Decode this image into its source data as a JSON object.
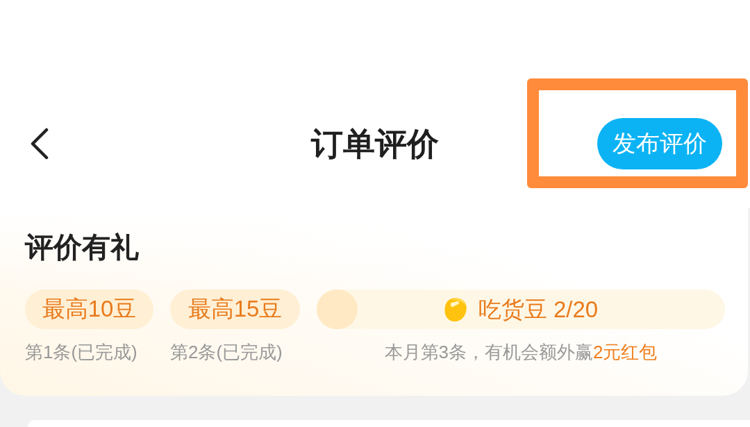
{
  "header": {
    "title": "订单评价",
    "publish_button": {
      "label": "发布评价",
      "highlighted": true
    }
  },
  "rewards": {
    "title": "评价有礼",
    "items": [
      {
        "kind": "pill",
        "badge": "最高10豆",
        "caption": "第1条(已完成)"
      },
      {
        "kind": "pill",
        "badge": "最高15豆",
        "caption": "第2条(已完成)"
      },
      {
        "kind": "progress",
        "label": "吃货豆 2/20",
        "level": 0.1,
        "caption": "本月第3条，有机会额外赢",
        "caption_highlight": "2元红包"
      }
    ]
  }
}
